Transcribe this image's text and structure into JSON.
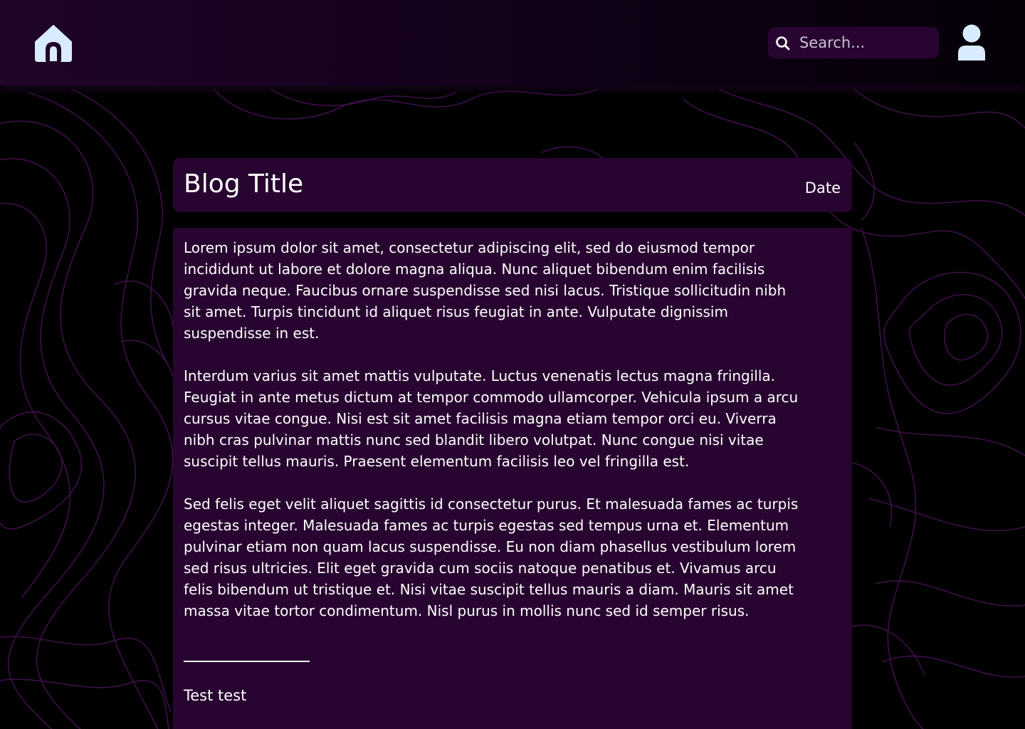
{
  "header": {
    "home_icon": "home-icon",
    "search": {
      "icon": "search-icon",
      "placeholder": "Search...",
      "value": ""
    },
    "user_icon": "user-icon"
  },
  "post": {
    "title": "Blog Title",
    "date": "Date",
    "paragraphs": [
      "Lorem  ipsum dolor sit amet, consectetur adipiscing elit, sed do eiusmod  tempor\nincididunt ut labore et dolore magna aliqua. Nunc aliquet  bibendum enim facilisis\ngravida neque. Faucibus ornare suspendisse sed  nisi lacus. Tristique sollicitudin nibh\nsit amet. Turpis tincidunt id  aliquet risus feugiat in ante. Vulputate dignissim\nsuspendisse in est.",
      "Interdum varius sit amet mattis vulputate. Luctus venenatis lectus magna  fringilla.\nFeugiat in ante metus dictum at tempor commodo ullamcorper.  Vehicula ipsum a arcu\ncursus vitae congue. Nisi est sit amet facilisis  magna etiam tempor orci eu. Viverra\nnibh cras pulvinar mattis nunc sed  blandit libero volutpat. Nunc congue nisi vitae\nsuscipit tellus mauris.  Praesent elementum facilisis leo vel fringilla est.",
      "Sed felis eget velit aliquet sagittis id consectetur purus. Et  malesuada fames ac turpis\negestas integer. Malesuada fames ac turpis  egestas sed tempus urna et. Elementum\npulvinar etiam non quam lacus  suspendisse. Eu non diam phasellus vestibulum lorem\nsed risus ultricies.  Elit eget gravida cum sociis natoque penatibus et. Vivamus arcu\nfelis  bibendum ut tristique et. Nisi vitae suscipit tellus mauris a diam.  Mauris sit amet\nmassa vitae tortor condimentum. Nisl purus in mollis  nunc sed id semper risus."
    ],
    "signature": "Test test"
  },
  "colors": {
    "page_background": "#000000",
    "header_gradient_start": "#1f0428",
    "card_background": "#280530",
    "icon_fill": "#d9ecff",
    "text": "#ffffff",
    "topo_lines": "#4a1258"
  }
}
